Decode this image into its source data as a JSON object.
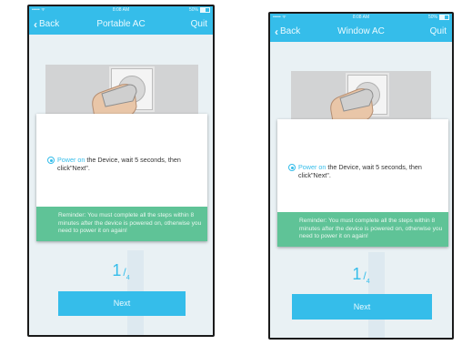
{
  "statusbar": {
    "signal": "••••• ᯤ",
    "time": "8:08 AM",
    "battery": "50%"
  },
  "screens": [
    {
      "back_label": "Back",
      "title": "Portable AC",
      "quit_label": "Quit",
      "instruction_highlight": "Power on",
      "instruction_rest": " the Device, wait 5 seconds, then click\"Next\".",
      "reminder": "Reminder: You must complete all the steps within 8 minutes after the device is powered on, otherwise you need to power it on again!",
      "step_current": "1",
      "step_total": "4",
      "next_label": "Next"
    },
    {
      "back_label": "Back",
      "title": "Window AC",
      "quit_label": "Quit",
      "instruction_highlight": "Power on",
      "instruction_rest": " the Device, wait 5 seconds, then click\"Next\".",
      "reminder": "Reminder: You must complete all the steps within 8 minutes after the device is powered on, otherwise you need to power it on again!",
      "step_current": "1",
      "step_total": "4",
      "next_label": "Next"
    }
  ],
  "colors": {
    "accent": "#35bdea",
    "reminder": "#5fc397",
    "background": "#e9f1f4"
  }
}
